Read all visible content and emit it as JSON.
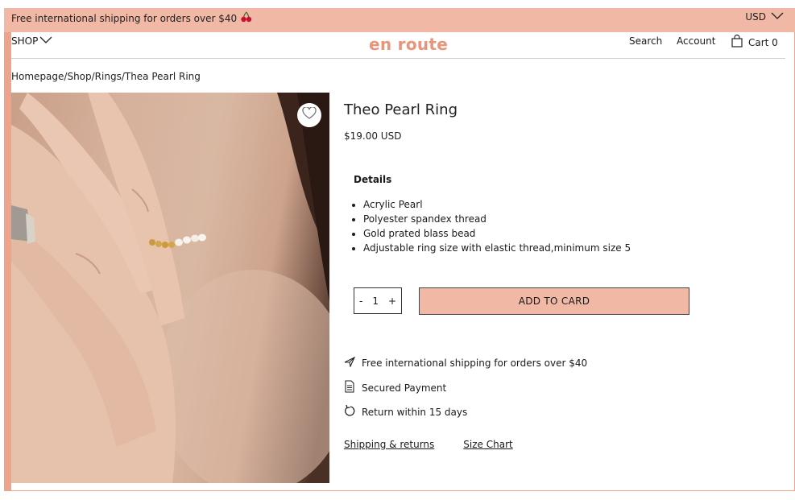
{
  "topbar": {
    "shipping_text": "Free international shipping for orders over $40",
    "currency": "USD",
    "background": "#f2b8a6"
  },
  "nav": {
    "shop_label": "SHOP",
    "logo": "en route",
    "search_label": "Search",
    "account_label": "Account",
    "cart_label": "Cart 0"
  },
  "breadcrumb": "Homepage/Shop/Rings/Thea Pearl Ring",
  "product": {
    "title": "Theo Pearl Ring",
    "price": "$19.00 USD",
    "details_heading": "Details",
    "details": [
      "Acrylic Pearl",
      "Polyester spandex thread",
      "Gold prated blass bead",
      "Adjustable ring size with elastic thread,minimum size 5"
    ],
    "quantity": {
      "minus": "-",
      "value": "1",
      "plus": "+"
    },
    "add_button": "ADD TO CARD"
  },
  "perks": [
    {
      "icon": "plane-icon",
      "text": "Free international shipping for orders over $40"
    },
    {
      "icon": "document-icon",
      "text": "Secured Payment"
    },
    {
      "icon": "return-icon",
      "text": "Return within 15 days"
    }
  ],
  "links": {
    "shipping": "Shipping & returns",
    "size_chart": "Size Chart"
  },
  "colors": {
    "accent": "#f2b8a6",
    "logo": "#e8957a",
    "frame": "#eea48c"
  }
}
